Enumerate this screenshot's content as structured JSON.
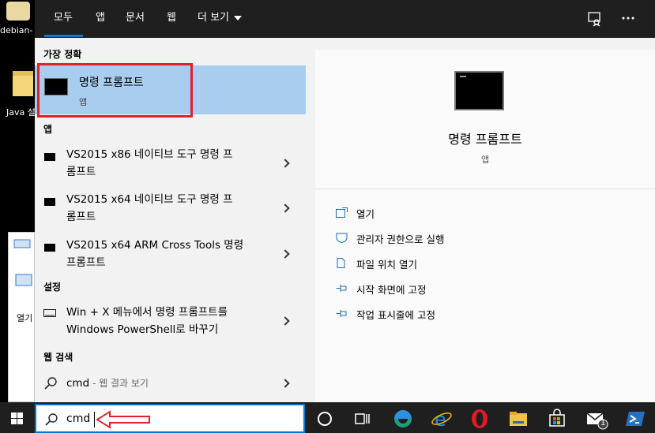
{
  "desktop": {
    "icon1_label": "debian-",
    "icon2_label": "Java 설",
    "window_label": "열기"
  },
  "tabs": [
    {
      "label": "모두",
      "active": true
    },
    {
      "label": "앱"
    },
    {
      "label": "문서"
    },
    {
      "label": "웹"
    },
    {
      "label": "더 보기"
    }
  ],
  "topbar_icons": [
    "feedback-icon",
    "more-options-icon"
  ],
  "best_match": {
    "section_title": "가장 정확",
    "title": "명령 프롬프트",
    "subtitle": "앱"
  },
  "apps": {
    "section_title": "앱",
    "items": [
      {
        "line1": "VS2015 x86 네이티브 도구 명령 프",
        "line2": "롬프트"
      },
      {
        "line1": "VS2015 x64 네이티브 도구 명령 프",
        "line2": "롬프트"
      },
      {
        "line1": "VS2015 x64 ARM Cross Tools 명령",
        "line2": "프롬프트"
      }
    ]
  },
  "settings": {
    "section_title": "설정",
    "items": [
      {
        "line1": "Win + X 메뉴에서 명령 프롬프트를",
        "line2": "Windows PowerShell로 바꾸기"
      }
    ]
  },
  "web": {
    "section_title": "웹 검색",
    "query": "cmd",
    "hint": " - 웹 결과 보기"
  },
  "preview": {
    "title": "명령 프롬프트",
    "subtitle": "앱",
    "actions": [
      {
        "label": "열기",
        "icon": "open-icon"
      },
      {
        "label": "관리자 권한으로 실행",
        "icon": "shield-icon"
      },
      {
        "label": "파일 위치 열기",
        "icon": "file-location-icon"
      },
      {
        "label": "시작 화면에 고정",
        "icon": "pin-icon"
      },
      {
        "label": "작업 표시줄에 고정",
        "icon": "pin-icon"
      }
    ]
  },
  "search": {
    "value": "cmd"
  },
  "taskbar": {
    "icons": [
      "windows-start-icon",
      "cortana-icon",
      "task-view-icon",
      "edge-icon",
      "ie-icon",
      "opera-icon",
      "file-explorer-icon",
      "store-icon",
      "mail-icon",
      "powershell-icon"
    ],
    "mail_badge": "1"
  },
  "colors": {
    "accent": "#0078d7",
    "highlight": "#a8cdee",
    "annotation_red": "#e0202b"
  }
}
